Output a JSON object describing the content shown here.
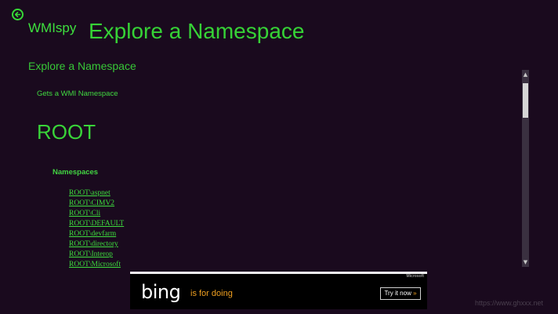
{
  "app": {
    "name": "WMIspy",
    "back_icon": "back-arrow-circle-icon"
  },
  "header": {
    "title": "Explore a Namespace"
  },
  "main": {
    "section_title": "Explore a Namespace",
    "subtitle": "Gets a WMI Namespace",
    "root": "ROOT",
    "namespaces_label": "Namespaces",
    "namespaces": [
      "ROOT\\aspnet",
      "ROOT\\CIMV2",
      "ROOT\\Cli",
      "ROOT\\DEFAULT",
      "ROOT\\devfarm",
      "ROOT\\directory",
      "ROOT\\Interop",
      "ROOT\\Microsoft"
    ]
  },
  "ad": {
    "brand_tag": "Microsoft",
    "logo": "bing",
    "tagline": "is for doing",
    "button": "Try it now",
    "button_chevron": "»"
  },
  "watermark": "https://www.ghxxx.net",
  "colors": {
    "background": "#1a0a1e",
    "accent": "#36d236",
    "ad_orange": "#f0a020"
  }
}
